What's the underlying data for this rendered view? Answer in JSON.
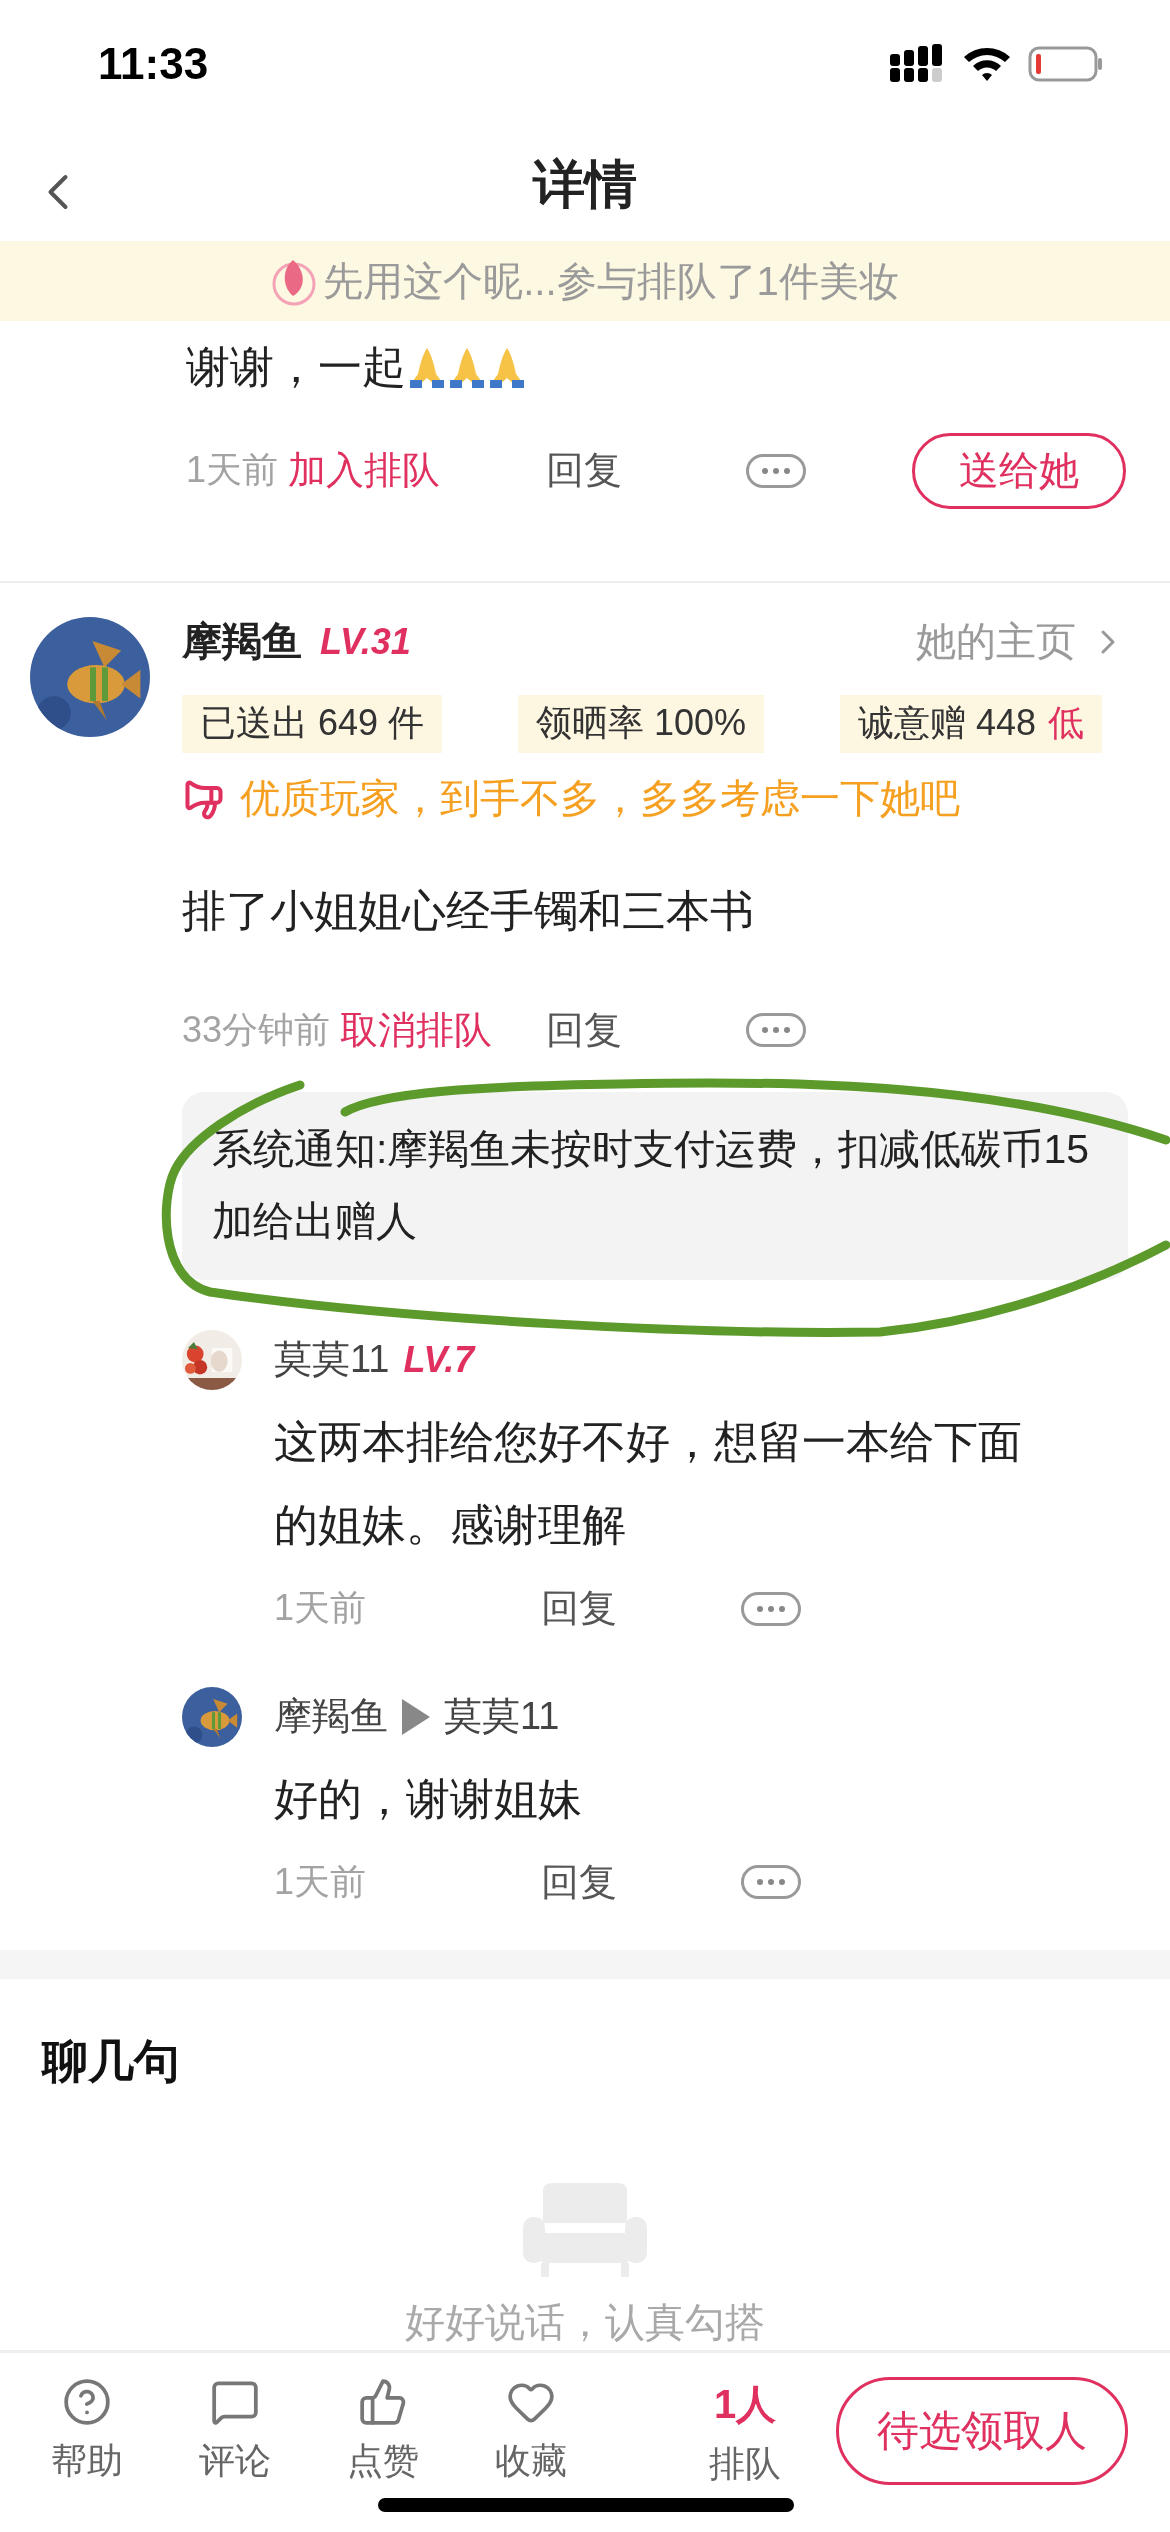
{
  "status_bar": {
    "time": "11:33"
  },
  "nav": {
    "title": "详情"
  },
  "banner": {
    "text": "先用这个昵...参与排队了1件美妆"
  },
  "previous_comment": {
    "text": "谢谢，一起",
    "time": "1天前",
    "action": "加入排队",
    "reply": "回复",
    "gift_button": "送给她"
  },
  "comment": {
    "user": {
      "name": "摩羯鱼",
      "level": "LV.31",
      "home_link": "她的主页"
    },
    "stats": [
      {
        "label": "已送出 649 件"
      },
      {
        "label": "领晒率 100%"
      },
      {
        "label": "诚意赠 448",
        "flag": "低"
      }
    ],
    "notice": "优质玩家，到手不多，多多考虑一下她吧",
    "text": "排了小姐姐心经手镯和三本书",
    "time": "33分钟前",
    "action": "取消排队",
    "reply": "回复",
    "system_notice": "系统通知:摩羯鱼未按时支付运费，扣减低碳币15加给出赠人",
    "replies": [
      {
        "name": "莫莫11",
        "level": "LV.7",
        "text": "这两本排给您好不好，想留一本给下面的姐妹。感谢理解",
        "time": "1天前",
        "reply": "回复"
      },
      {
        "name": "摩羯鱼",
        "reply_to": "莫莫11",
        "text": "好的，谢谢姐妹",
        "time": "1天前",
        "reply": "回复"
      }
    ]
  },
  "chat": {
    "title": "聊几句",
    "empty_text": "好好说话，认真勾搭"
  },
  "tab_bar": {
    "items": [
      {
        "kind": "help",
        "label": "帮助"
      },
      {
        "kind": "comment",
        "label": "评论"
      },
      {
        "kind": "like",
        "label": "点赞"
      },
      {
        "kind": "favorite",
        "label": "收藏"
      }
    ],
    "queue": {
      "count": "1人",
      "label": "排队"
    },
    "button": "待选领取人"
  }
}
